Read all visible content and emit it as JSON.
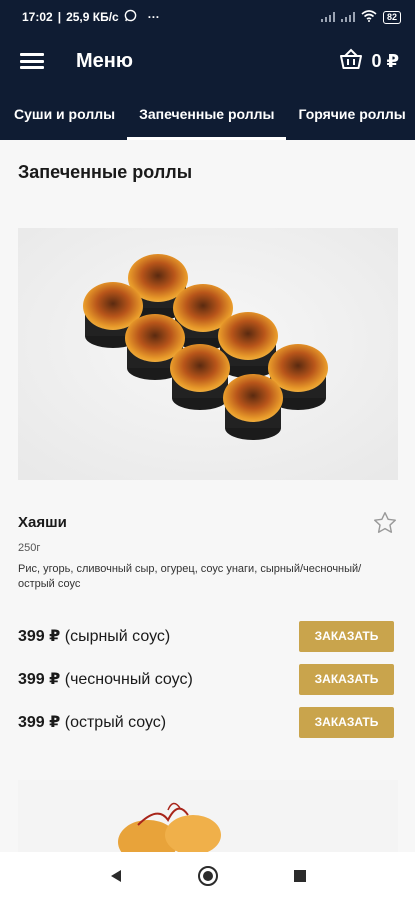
{
  "status_bar": {
    "time": "17:02",
    "net_speed": "25,9 КБ/с",
    "more": "···",
    "battery": "82"
  },
  "header": {
    "title": "Меню",
    "cart_total": "0 ₽"
  },
  "tabs": [
    {
      "label": "Суши и роллы",
      "active": false
    },
    {
      "label": "Запеченные роллы",
      "active": true
    },
    {
      "label": "Горячие роллы",
      "active": false
    }
  ],
  "section": {
    "title": "Запеченные роллы"
  },
  "product": {
    "name": "Хаяши",
    "weight": "250г",
    "description": "Рис, угорь, сливочный сыр, огурец, соус унаги, сырный/чесночный/острый соус",
    "options": [
      {
        "price": "399 ₽",
        "sauce": "(сырный соус)",
        "button": "ЗАКАЗАТЬ"
      },
      {
        "price": "399 ₽",
        "sauce": "(чесночный соус)",
        "button": "ЗАКАЗАТЬ"
      },
      {
        "price": "399 ₽",
        "sauce": "(острый соус)",
        "button": "ЗАКАЗАТЬ"
      }
    ]
  },
  "colors": {
    "header_bg": "#0f1c33",
    "accent": "#c9a44c"
  },
  "icons": {
    "menu": "hamburger-icon",
    "cart": "basket-icon",
    "favorite": "star-outline-icon",
    "nav_back": "back-triangle-icon",
    "nav_home": "home-circle-icon",
    "nav_recent": "recent-square-icon"
  }
}
